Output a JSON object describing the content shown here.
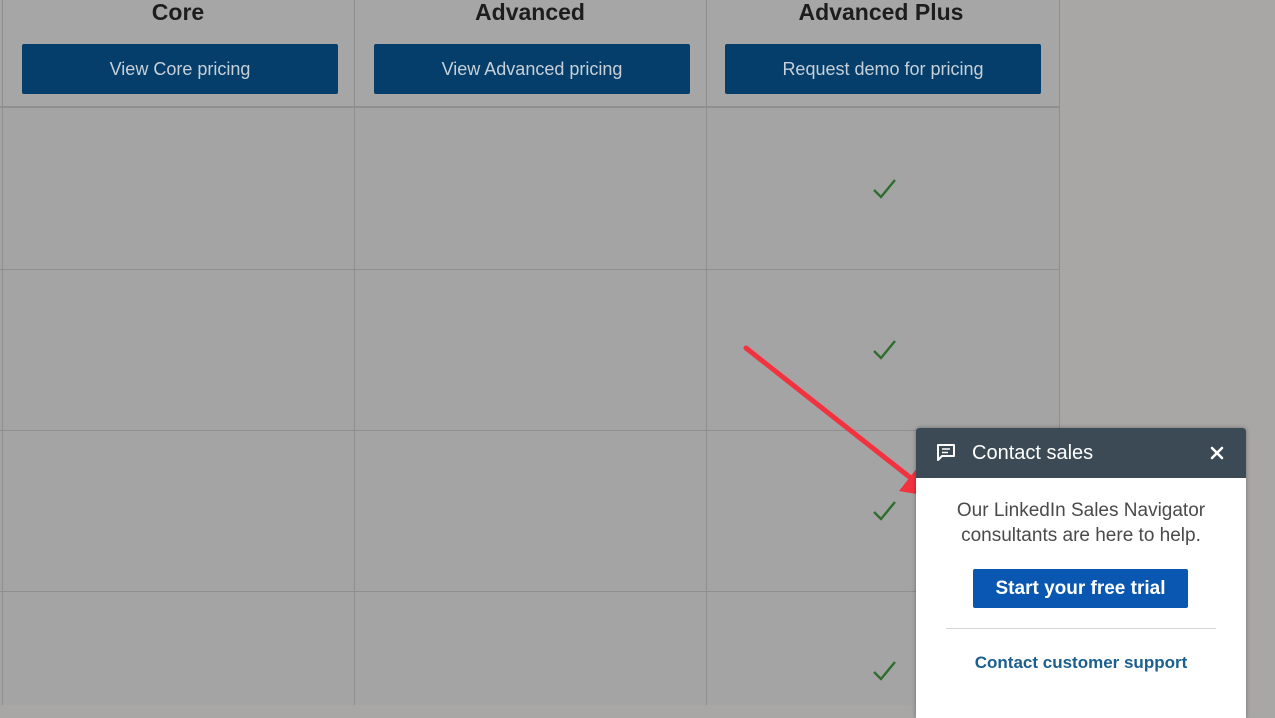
{
  "plans": [
    {
      "name": "Core",
      "button_label": "View Core pricing"
    },
    {
      "name": "Advanced",
      "button_label": "View Advanced pricing"
    },
    {
      "name": "Advanced Plus",
      "button_label": "Request demo for pricing"
    }
  ],
  "feature_rows": [
    {
      "core": false,
      "advanced": false,
      "advanced_plus": true
    },
    {
      "core": false,
      "advanced": false,
      "advanced_plus": true
    },
    {
      "core": false,
      "advanced": false,
      "advanced_plus": true
    },
    {
      "core": false,
      "advanced": false,
      "advanced_plus": true
    }
  ],
  "contact_widget": {
    "title": "Contact sales",
    "message": "Our LinkedIn Sales Navigator consultants are here to help.",
    "trial_button": "Start your free trial",
    "support_link": "Contact customer support"
  },
  "icons": {
    "chat": "chat-bubble-icon",
    "close": "close-icon",
    "check": "checkmark-icon"
  },
  "colors": {
    "page_overlay": "#a9a6a6",
    "plan_button": "#053e6a",
    "check": "#2f6e2f",
    "widget_header": "#3b4a54",
    "trial_button": "#0a57b2",
    "support_link": "#1a5f8e",
    "arrow": "#f2333f"
  }
}
